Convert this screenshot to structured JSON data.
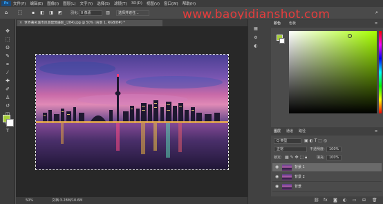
{
  "menu": {
    "items": [
      "文件(F)",
      "编辑(E)",
      "图像(I)",
      "图层(L)",
      "文字(Y)",
      "选择(S)",
      "滤镜(T)",
      "3D(D)",
      "视图(V)",
      "窗口(W)",
      "帮助(H)"
    ],
    "logo": "Ps"
  },
  "options": {
    "feather_label": "羽化:",
    "feather_value": "0 像素",
    "select_subject": "选择并遮住...",
    "watermark": "www.baoyidianshot.com"
  },
  "document": {
    "tab_title": "世界著名城市风景建筑摄影_(284).jpg @ 50% (背景 1, RGB/8#) *",
    "zoom": "50%",
    "doc_info": "文档:3.28M/10.6M"
  },
  "color_panel": {
    "tab_color": "颜色",
    "tab_swatches": "色板",
    "fg_color": "#a6ce39",
    "bg_color": "#ffffff"
  },
  "layers_panel": {
    "tab_layers": "图层",
    "tab_channels": "通道",
    "tab_paths": "路径",
    "kind_filter": "Q 类型",
    "blend_mode": "正常",
    "opacity_label": "不透明度:",
    "opacity_value": "100%",
    "lock_label": "锁定:",
    "fill_label": "填充:",
    "fill_value": "100%",
    "layers": [
      {
        "name": "背景 1",
        "selected": true
      },
      {
        "name": "背景 2",
        "selected": false
      },
      {
        "name": "背景",
        "selected": false
      }
    ]
  }
}
